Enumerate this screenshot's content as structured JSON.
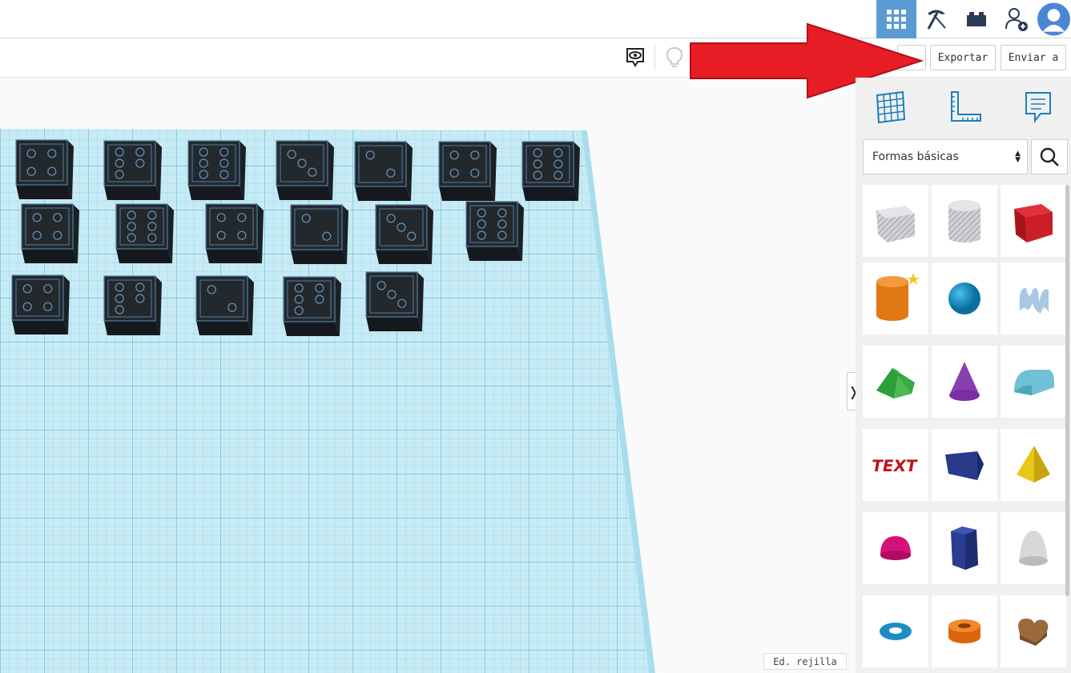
{
  "toolbar": {
    "export_label": "Exportar",
    "send_label": "Enviar a"
  },
  "top_icons": [
    "grid-view-icon",
    "pickaxe-icon",
    "bricks-icon",
    "add-user-icon",
    "avatar"
  ],
  "viewport": {
    "grid_edit_label": "Ed. rejilla"
  },
  "panel": {
    "shape_category": "Formas básicas",
    "tools": [
      "grid-tool-icon",
      "ruler-tool-icon",
      "notes-tool-icon"
    ],
    "shapes": [
      {
        "name": "hole-box"
      },
      {
        "name": "hole-cylinder"
      },
      {
        "name": "box"
      },
      {
        "name": "cylinder"
      },
      {
        "name": "sphere"
      },
      {
        "name": "scribble"
      },
      {
        "name": "roof"
      },
      {
        "name": "cone"
      },
      {
        "name": "round-roof"
      },
      {
        "name": "text"
      },
      {
        "name": "polygon"
      },
      {
        "name": "pyramid"
      },
      {
        "name": "half-sphere"
      },
      {
        "name": "prism"
      },
      {
        "name": "paraboloid"
      },
      {
        "name": "torus"
      },
      {
        "name": "tube"
      },
      {
        "name": "heart"
      }
    ]
  },
  "colors": {
    "accent": "#5b9bd5",
    "arrow": "#e81c24",
    "workplane": "#c7ebf5",
    "dice": "#23282d"
  },
  "dice_pips": [
    4,
    5,
    6,
    3,
    2,
    4,
    6,
    4,
    6,
    4,
    2,
    3,
    6,
    4,
    5,
    2,
    5,
    3
  ]
}
